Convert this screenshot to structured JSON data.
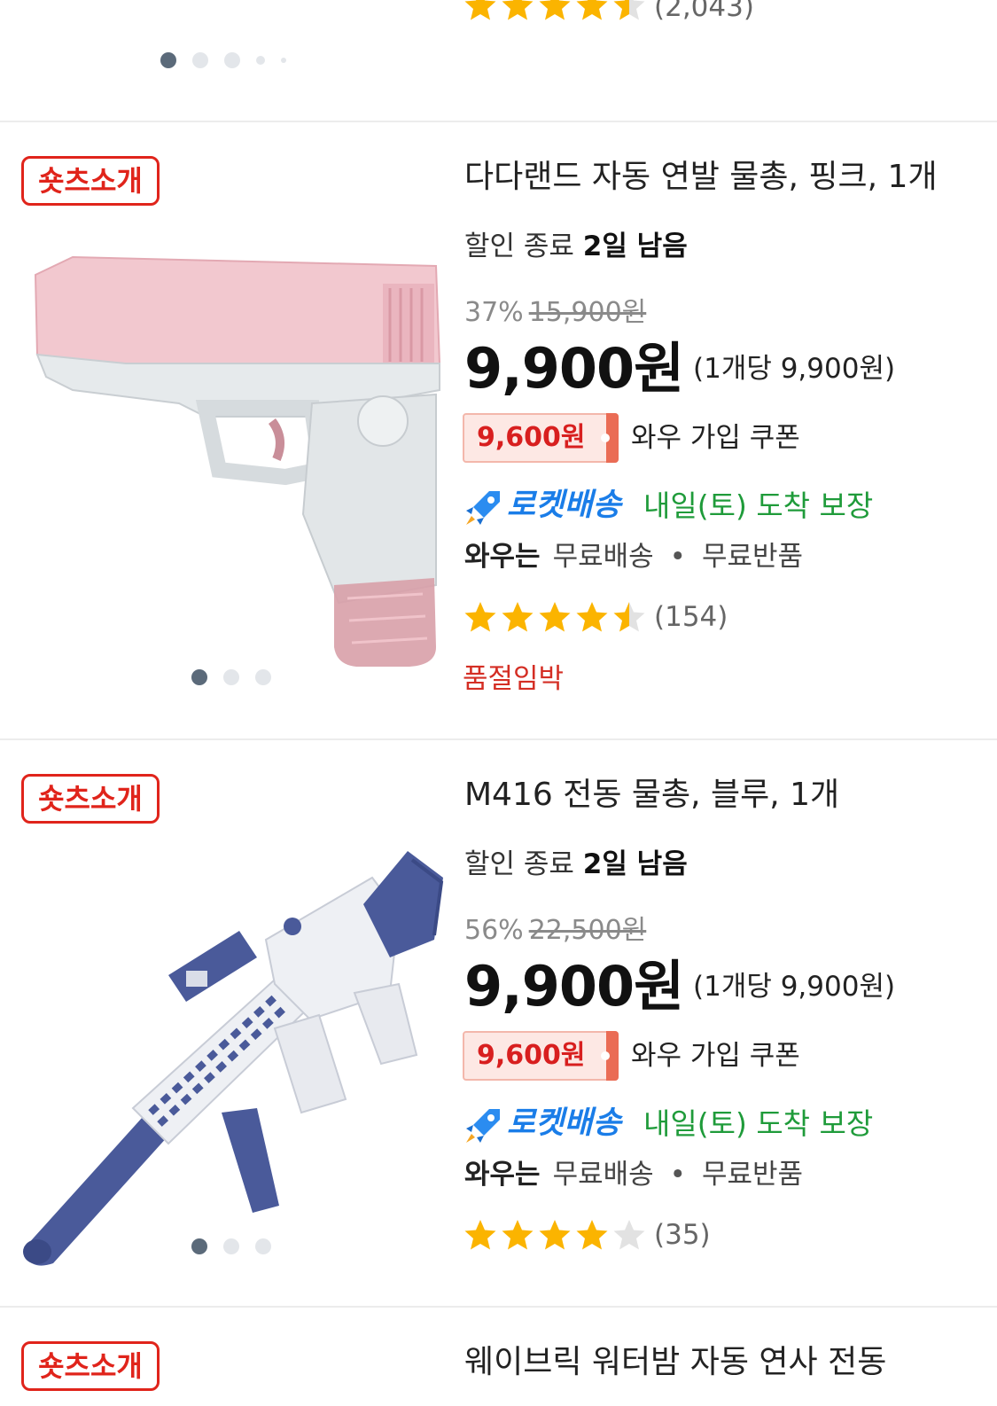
{
  "top_partial": {
    "rating_count": "(2,043)",
    "stars_filled": 4.5
  },
  "products": [
    {
      "badge": "숏츠소개",
      "title": "다다랜드 자동 연발 물총, 핑크, 1개",
      "deadline_prefix": "할인 종료",
      "deadline_days": "2일 남음",
      "discount": "37%",
      "original_price": "15,900원",
      "price": "9,900원",
      "unit_price": "(1개당 9,900원)",
      "coupon_amount": "9,600원",
      "coupon_label": "와우 가입 쿠폰",
      "delivery_label": "로켓배송",
      "arrival": "내일(토) 도착 보장",
      "wow_prefix": "와우는",
      "wow_shipping": "무료배송",
      "wow_return": "무료반품",
      "rating": 4.5,
      "rating_count": "(154)",
      "stock_note": "품절임박",
      "image_colors": {
        "body": "#f2c8cf",
        "frame": "#e6eaec"
      }
    },
    {
      "badge": "숏츠소개",
      "title": "M416 전동 물총, 블루, 1개",
      "deadline_prefix": "할인 종료",
      "deadline_days": "2일 남음",
      "discount": "56%",
      "original_price": "22,500원",
      "price": "9,900원",
      "unit_price": "(1개당 9,900원)",
      "coupon_amount": "9,600원",
      "coupon_label": "와우 가입 쿠폰",
      "delivery_label": "로켓배송",
      "arrival": "내일(토) 도착 보장",
      "wow_prefix": "와우는",
      "wow_shipping": "무료배송",
      "wow_return": "무료반품",
      "rating": 4,
      "rating_count": "(35)",
      "image_colors": {
        "body": "#eef0f4",
        "accent": "#4a5a9a"
      }
    },
    {
      "badge": "숏츠소개",
      "title": "웨이브릭 워터밤 자동 연사 전동"
    }
  ],
  "colors": {
    "badge_red": "#e0241b",
    "star_yellow": "#fbb400",
    "star_empty": "#e2e2e2",
    "rocket_blue": "#1a7de8",
    "arrival_green": "#1f9b3a",
    "coupon_red": "#d81f1f"
  }
}
